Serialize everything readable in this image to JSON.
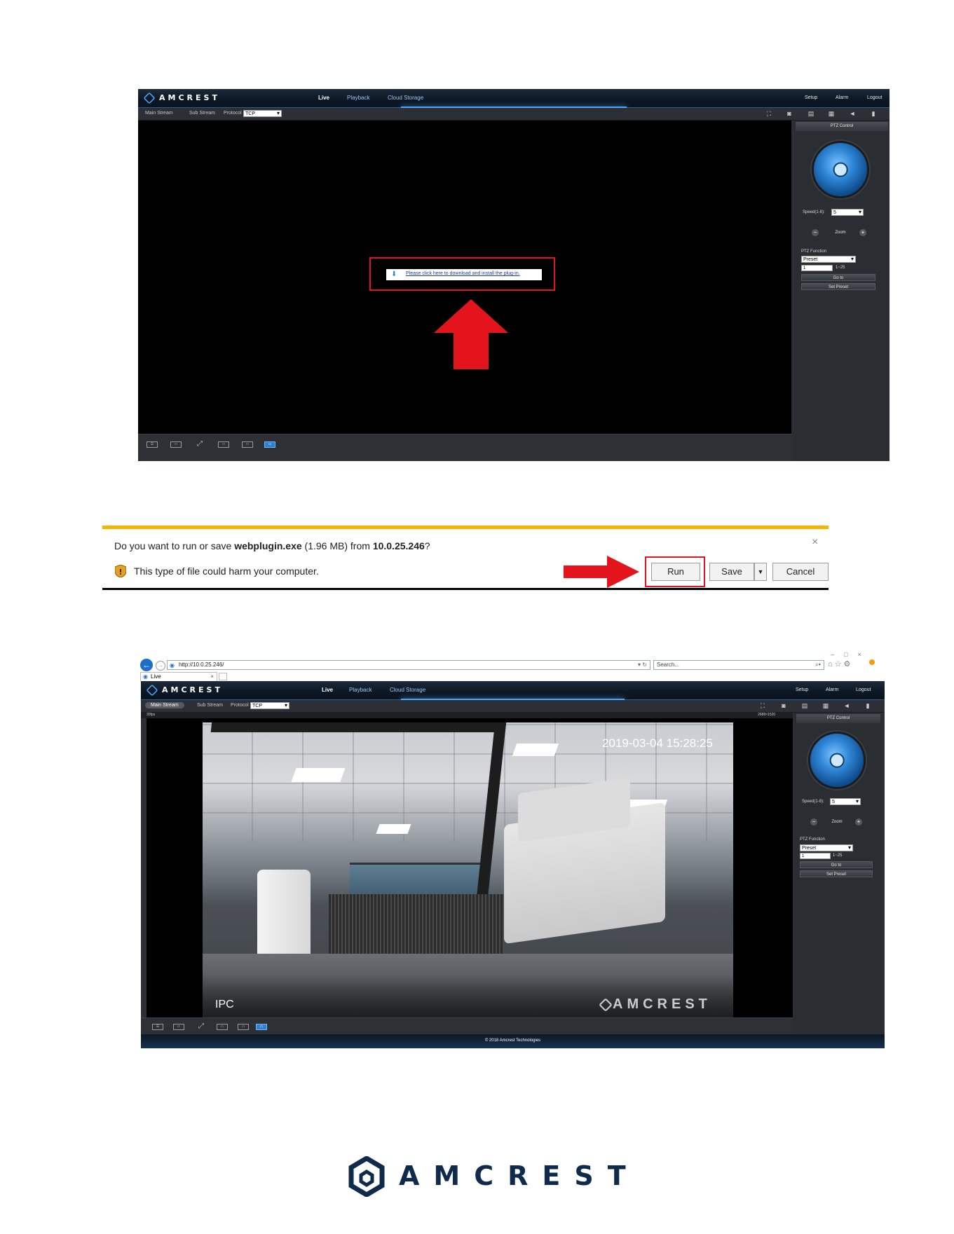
{
  "app": {
    "brand": "AMCREST",
    "nav": [
      "Live",
      "Playback",
      "Cloud Storage"
    ],
    "nav_right": [
      "Setup",
      "Alarm",
      "Logout"
    ],
    "stream_tabs": [
      "Main Stream",
      "Sub Stream"
    ],
    "protocol_label": "Protocol",
    "protocol_value": "TCP",
    "plugin_link": "Please click here to download and install the plug-in.",
    "ptz": {
      "title": "PTZ Control",
      "speed_label": "Speed(1-8):",
      "speed_value": "5",
      "zoom_label": "Zoom",
      "function_label": "PTZ Function",
      "function_value": "Preset",
      "preset_value": "1",
      "preset_range": "1~25",
      "goto_label": "Go to",
      "set_preset_label": "Set Preset"
    },
    "bottom_icons": [
      "adjust-icon",
      "ratio-icon",
      "fullscreen-icon",
      "smooth-icon",
      "realtime-icon",
      "fluency-icon"
    ],
    "accent_color": "#4ea8ff",
    "highlight_color": "#e3141c"
  },
  "download_bar": {
    "prompt_prefix": "Do you want to run or save ",
    "filename": "webplugin.exe",
    "size": " (1.96 MB) from ",
    "host": "10.0.25.246",
    "suffix": "?",
    "warning": "This type of file could harm your computer.",
    "run_label": "Run",
    "save_label": "Save",
    "cancel_label": "Cancel",
    "close_glyph": "×",
    "stripe_color": "#f4b400"
  },
  "browser": {
    "url": "http://10.0.25.246/",
    "search_placeholder": "Search...",
    "tab_title": "Live",
    "window_controls": [
      "–",
      "□",
      "×"
    ]
  },
  "live_view": {
    "fps": "30fps",
    "resolution": "2688×1520",
    "timestamp": "2019-03-04 15:28:25",
    "channel_label": "IPC",
    "watermark": "AMCREST",
    "footer": "© 2018 Amcrest Technologies"
  },
  "footer_logo": "AMCREST"
}
